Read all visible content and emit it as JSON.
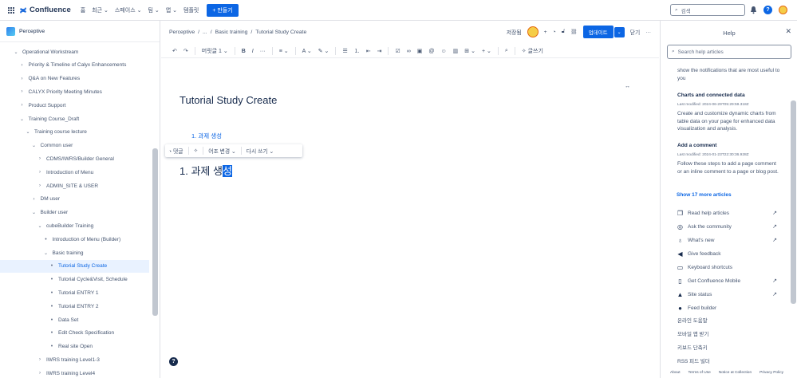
{
  "topbar": {
    "app_name": "Confluence",
    "nav": [
      "홈",
      "최근",
      "스페이스",
      "팀",
      "앱",
      "템플릿"
    ],
    "create_label": "+ 만들기",
    "search_placeholder": "검색"
  },
  "sidebar": {
    "space_name": "Perceptive",
    "tree": [
      {
        "label": "Operational Workstream",
        "indent": 0,
        "chev": "⌄",
        "selected": false
      },
      {
        "label": "Priority & Timeline of Calyx Enhancements",
        "indent": 1,
        "chev": "›",
        "selected": false
      },
      {
        "label": "Q&A on New Features",
        "indent": 1,
        "chev": "›",
        "selected": false
      },
      {
        "label": "CALYX Priority Meeting Minutes",
        "indent": 1,
        "chev": "›",
        "selected": false
      },
      {
        "label": "Product Support",
        "indent": 1,
        "chev": "›",
        "selected": false
      },
      {
        "label": "Training Course_Draft",
        "indent": 1,
        "chev": "⌄",
        "selected": false
      },
      {
        "label": "Training course lecture",
        "indent": 2,
        "chev": "⌄",
        "selected": false
      },
      {
        "label": "Common user",
        "indent": 3,
        "chev": "⌄",
        "selected": false
      },
      {
        "label": "CDMS/IWRS/Builder General",
        "indent": 4,
        "chev": "›",
        "selected": false
      },
      {
        "label": "Introduction of Menu",
        "indent": 4,
        "chev": "›",
        "selected": false
      },
      {
        "label": "ADMIN_SITE & USER",
        "indent": 4,
        "chev": "›",
        "selected": false
      },
      {
        "label": "DM user",
        "indent": 3,
        "chev": "›",
        "selected": false
      },
      {
        "label": "Builder user",
        "indent": 3,
        "chev": "⌄",
        "selected": false
      },
      {
        "label": "cubeBuilder Training",
        "indent": 4,
        "chev": "⌄",
        "selected": false
      },
      {
        "label": "Introduction of Menu (Builder)",
        "indent": 5,
        "chev": "•",
        "selected": false
      },
      {
        "label": "Basic training",
        "indent": 5,
        "chev": "⌄",
        "selected": false
      },
      {
        "label": "Tutorial Study Create",
        "indent": 6,
        "chev": "•",
        "selected": true
      },
      {
        "label": "Tutorial Cycle&Visit, Schedule",
        "indent": 6,
        "chev": "•",
        "selected": false
      },
      {
        "label": "Tutorial ENTRY 1",
        "indent": 6,
        "chev": "•",
        "selected": false
      },
      {
        "label": "Tutorial ENTRY 2",
        "indent": 6,
        "chev": "•",
        "selected": false
      },
      {
        "label": "Data Set",
        "indent": 6,
        "chev": "•",
        "selected": false
      },
      {
        "label": "Edit Check Specification",
        "indent": 6,
        "chev": "•",
        "selected": false
      },
      {
        "label": "Real site Open",
        "indent": 6,
        "chev": "•",
        "selected": false
      },
      {
        "label": "IWRS training Level1-3",
        "indent": 4,
        "chev": "›",
        "selected": false
      },
      {
        "label": "IWRS training Level4",
        "indent": 4,
        "chev": "›",
        "selected": false
      }
    ]
  },
  "editor": {
    "breadcrumb": [
      "Perceptive",
      "...",
      "Basic training",
      "Tutorial Study Create"
    ],
    "saved_label": "저장됨",
    "update_label": "업데이트",
    "close_label": "닫기",
    "more_label": "···",
    "toolbar": {
      "text_style": "머릿글 1",
      "write_label": "글쓰기"
    },
    "page_title": "Tutorial Study Create",
    "toc_link": "1. 과제 생성",
    "float_toolbar": {
      "comment": "댓글",
      "tone": "어조 변경",
      "rewrite": "다시 쓰기"
    },
    "heading_prefix": "1. 과제 생",
    "heading_selected": "성"
  },
  "help": {
    "title": "Help",
    "search_placeholder": "Search help articles",
    "articles": [
      {
        "title": "",
        "meta": "",
        "body": "show the notifications that are most useful to you"
      },
      {
        "title": "Charts and connected data",
        "meta": "Last modified: 2024-06-29T05:29:59.318Z",
        "body": "Create and customize dynamic charts from table data on your page for enhanced data visualization and analysis."
      },
      {
        "title": "Add a comment",
        "meta": "Last modified: 2024-01-23T22:30:36.928Z",
        "body": "Follow these steps to add a page comment or an inline comment to a page or blog post."
      }
    ],
    "show_more": "Show 17 more articles",
    "links": [
      {
        "label": "Read help articles",
        "icon": "book-icon",
        "glyph": "❐",
        "ext": true
      },
      {
        "label": "Ask the community",
        "icon": "community-icon",
        "glyph": "◎",
        "ext": true
      },
      {
        "label": "What's new",
        "icon": "lightbulb-icon",
        "glyph": "♁",
        "ext": true
      },
      {
        "label": "Give feedback",
        "icon": "megaphone-icon",
        "glyph": "◀",
        "ext": false
      },
      {
        "label": "Keyboard shortcuts",
        "icon": "keyboard-icon",
        "glyph": "▭",
        "ext": false
      },
      {
        "label": "Get Confluence Mobile",
        "icon": "mobile-icon",
        "glyph": "▯",
        "ext": true
      },
      {
        "label": "Site status",
        "icon": "warning-icon",
        "glyph": "▲",
        "ext": true
      },
      {
        "label": "Feed builder",
        "icon": "feed-icon",
        "glyph": "●",
        "ext": false
      }
    ],
    "plain_links": [
      "온라인 도움말",
      "모바일 앱 받기",
      "키보드 단축키",
      "RSS 피드 빌더"
    ],
    "footer": [
      "About",
      "Terms of Use",
      "Notice at Collection",
      "Privacy Policy"
    ]
  },
  "colors": {
    "brand": "#0c66e4",
    "text": "#172b4d",
    "selected_bg": "#e9f2ff"
  }
}
